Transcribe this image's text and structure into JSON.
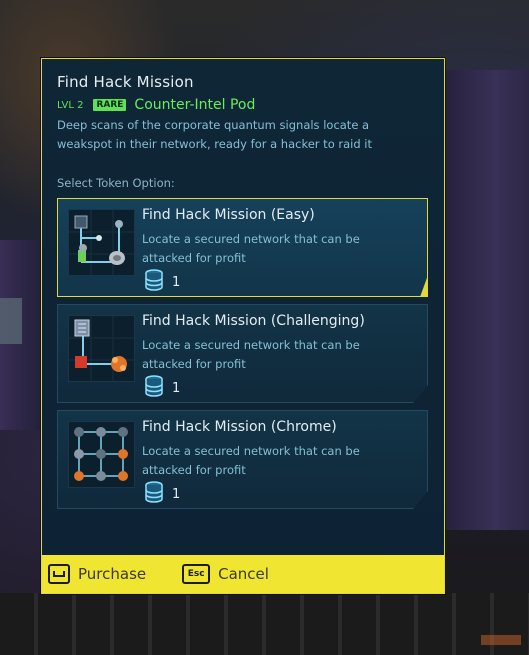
{
  "dialog": {
    "title": "Find Hack Mission",
    "level": "LVL 2",
    "rarity": "RARE",
    "item_name": "Counter-Intel Pod",
    "description": "Deep scans of the corporate quantum signals locate a weakspot in their network, ready for a hacker to raid it",
    "select_label": "Select Token Option:"
  },
  "options": [
    {
      "title": "Find Hack Mission (Easy)",
      "description": "Locate a secured network that can be attacked for profit",
      "cost": "1",
      "selected": true
    },
    {
      "title": "Find Hack Mission (Challenging)",
      "description": "Locate a secured network that can be attacked for profit",
      "cost": "1",
      "selected": false
    },
    {
      "title": "Find Hack Mission (Chrome)",
      "description": "Locate a secured network that can be attacked for profit",
      "cost": "1",
      "selected": false
    }
  ],
  "footer": {
    "purchase_label": "Purchase",
    "purchase_key_icon": "space-key-icon",
    "cancel_label": "Cancel",
    "cancel_key": "Esc"
  },
  "colors": {
    "accent_yellow": "#f0e632",
    "rare_green": "#63e35a",
    "panel_bg": "#0f2637",
    "body_text": "#86bfd4"
  },
  "icons": {
    "cost": "token-stack-icon"
  }
}
